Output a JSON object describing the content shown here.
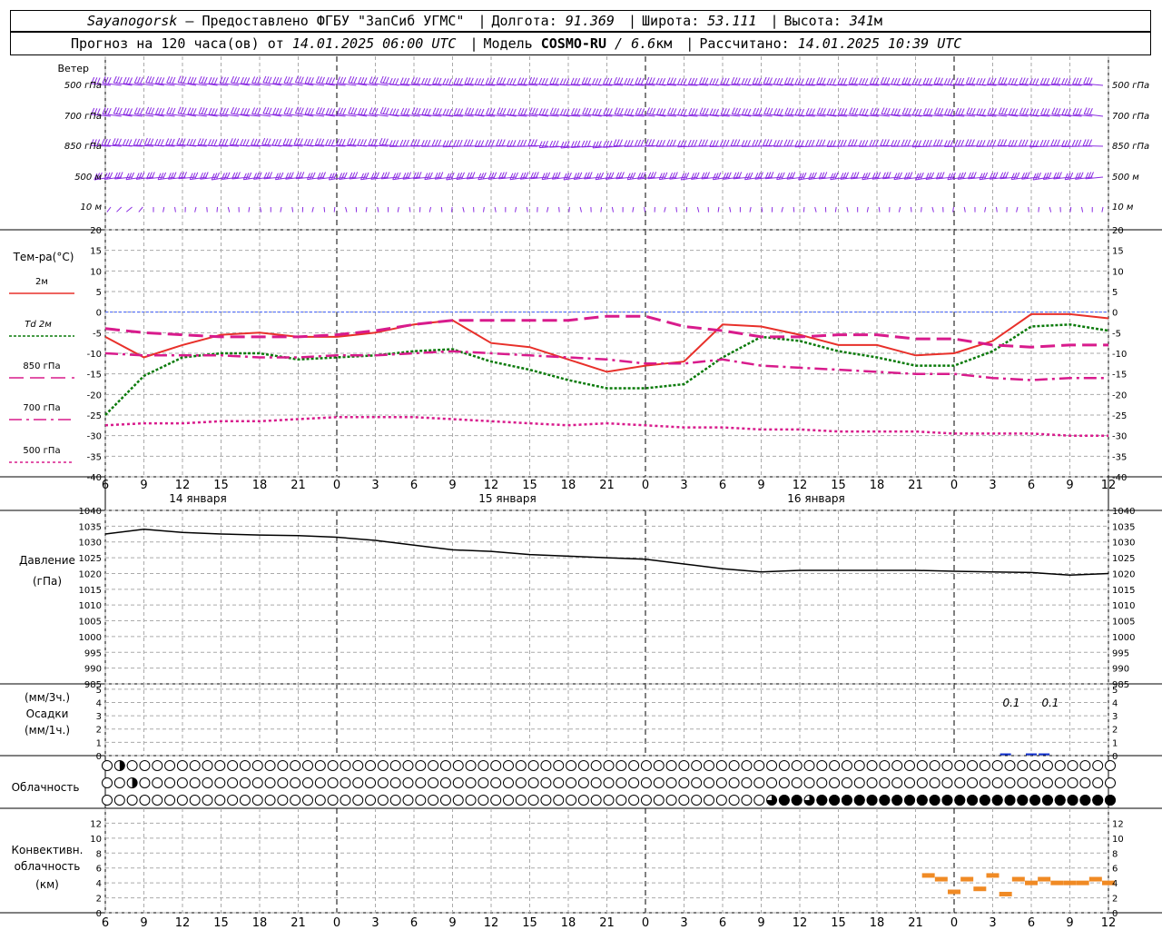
{
  "header": {
    "station": "Sayanogorsk",
    "provider_prefix": "—",
    "provider": "Предоставлено ФГБУ \"ЗапСиб УГМС\"",
    "lon_label": "Долгота:",
    "lon_value": "91.369",
    "lat_label": "Широта:",
    "lat_value": "53.111",
    "alt_label": "Высота:",
    "alt_value": "341",
    "alt_unit": "м",
    "forecast_label": "Прогноз на 120 часа(ов) от",
    "forecast_start": "14.01.2025 06:00 UTC",
    "model_label": "Модель",
    "model_name": "COSMO-RU",
    "model_res": "/ 6.6",
    "model_res_unit": "км",
    "calc_label": "Рассчитано:",
    "calc_time": "14.01.2025 10:39 UTC"
  },
  "wind_panel": {
    "title": "Ветер",
    "levels": [
      "500 гПа",
      "700 гПа",
      "850 гПа",
      "500 м",
      "10 м"
    ],
    "barb_color": "#8a2be2"
  },
  "temp_panel": {
    "title": "Тем-ра(°С)",
    "legend": [
      "2м",
      "Td 2м",
      "850 гПа",
      "700 гПа",
      "500 гПа"
    ],
    "yticks": [
      "20",
      "15",
      "10",
      "5",
      "0",
      "-5",
      "-10",
      "-15",
      "-20",
      "-25",
      "-30",
      "-35",
      "-40"
    ]
  },
  "pressure_panel": {
    "title": "Давление",
    "unit": "(гПа)",
    "yticks": [
      "1040",
      "1035",
      "1030",
      "1025",
      "1020",
      "1015",
      "1010",
      "1005",
      "1000",
      "995",
      "990",
      "985"
    ]
  },
  "precip_panel": {
    "unit_3h": "(мм/3ч.)",
    "title": "Осадки",
    "unit_1h": "(мм/1ч.)",
    "yticks": [
      "5",
      "4",
      "3",
      "2",
      "1",
      "0"
    ],
    "annotations": [
      "0.1",
      "0.1"
    ]
  },
  "cloud_panel": {
    "title": "Облачность"
  },
  "conv_panel": {
    "title_1": "Конвективн.",
    "title_2": "облачность",
    "unit": "(км)",
    "yticks": [
      "12",
      "10",
      "8",
      "6",
      "4",
      "2",
      "0"
    ]
  },
  "time_axis": {
    "ticks": [
      "6",
      "9",
      "12",
      "15",
      "18",
      "21",
      "0",
      "3",
      "6",
      "9",
      "12",
      "15",
      "18",
      "21",
      "0",
      "3",
      "6",
      "9",
      "12",
      "15",
      "18",
      "21",
      "0",
      "3",
      "6",
      "9",
      "12"
    ],
    "dates": [
      "14 января",
      "15 января",
      "16 января"
    ]
  },
  "colors": {
    "t2m": "#e8302a",
    "td2m": "#0a7a0a",
    "t850": "#d81b8c",
    "t700": "#d81b8c",
    "t500": "#d81b8c",
    "pressure": "#000000",
    "precip": "#1030d0",
    "conv": "#f08a24",
    "zero_line": "#4060ff"
  },
  "chart_data": {
    "type": "line",
    "x": [
      "14.01 06",
      "14.01 09",
      "14.01 12",
      "14.01 15",
      "14.01 18",
      "14.01 21",
      "15.01 00",
      "15.01 03",
      "15.01 06",
      "15.01 09",
      "15.01 12",
      "15.01 15",
      "15.01 18",
      "15.01 21",
      "16.01 00",
      "16.01 03",
      "16.01 06",
      "16.01 09",
      "16.01 12",
      "16.01 15",
      "16.01 18",
      "16.01 21",
      "17.01 00",
      "17.01 03",
      "17.01 06",
      "17.01 09",
      "17.01 12"
    ],
    "temperature": {
      "ylim": [
        -40,
        20
      ],
      "series": [
        {
          "name": "2м",
          "values": [
            -6,
            -11,
            -8,
            -5.5,
            -5,
            -6,
            -6,
            -5,
            -3,
            -2,
            -7.5,
            -8.5,
            -11.5,
            -14.5,
            -13,
            -12,
            -3,
            -3.5,
            -5.5,
            -8,
            -8,
            -10.5,
            -10,
            -7,
            -0.5,
            -0.5,
            -1.5
          ]
        },
        {
          "name": "Td 2м",
          "values": [
            -25,
            -15.5,
            -11,
            -10,
            -10,
            -11.5,
            -11,
            -10.5,
            -9.5,
            -9,
            -12,
            -14,
            -16.5,
            -18.5,
            -18.5,
            -17.5,
            -11,
            -6,
            -7,
            -9.5,
            -11,
            -13,
            -13,
            -9.5,
            -3.5,
            -3,
            -4.5
          ]
        },
        {
          "name": "850 гПа",
          "values": [
            -4,
            -5,
            -5.5,
            -6,
            -6,
            -6,
            -5.5,
            -4.5,
            -3,
            -2,
            -2,
            -2,
            -2,
            -1,
            -1,
            -3.5,
            -4.5,
            -6,
            -6,
            -5.5,
            -5.5,
            -6.5,
            -6.5,
            -8,
            -8.5,
            -8,
            -8
          ]
        },
        {
          "name": "700 гПа",
          "values": [
            -10,
            -10.5,
            -10.5,
            -10.5,
            -11,
            -11,
            -10.5,
            -10.5,
            -10,
            -9.5,
            -10,
            -10.5,
            -11,
            -11.5,
            -12.5,
            -12.5,
            -11.5,
            -13,
            -13.5,
            -14,
            -14.5,
            -15,
            -15,
            -16,
            -16.5,
            -16,
            -16
          ]
        },
        {
          "name": "500 гПа",
          "values": [
            -27.5,
            -27,
            -27,
            -26.5,
            -26.5,
            -26,
            -25.5,
            -25.5,
            -25.5,
            -26,
            -26.5,
            -27,
            -27.5,
            -27,
            -27.5,
            -28,
            -28,
            -28.5,
            -28.5,
            -29,
            -29,
            -29,
            -29.5,
            -29.5,
            -29.5,
            -30,
            -30
          ]
        }
      ]
    },
    "pressure": {
      "ylim": [
        985,
        1040
      ],
      "values": [
        1032.5,
        1034,
        1033,
        1032.5,
        1032.2,
        1032,
        1031.5,
        1030.5,
        1029,
        1027.5,
        1027,
        1026,
        1025.5,
        1025,
        1024.5,
        1023,
        1021.5,
        1020.5,
        1021,
        1021,
        1021,
        1021,
        1020.7,
        1020.5,
        1020.3,
        1019.5,
        1020
      ]
    },
    "precipitation": {
      "ylim": [
        0,
        5
      ],
      "bars": [
        {
          "hour": "17.01 04",
          "value": 0.1
        },
        {
          "hour": "17.01 06",
          "value": 0.1
        },
        {
          "hour": "17.01 07",
          "value": 0.1
        }
      ]
    },
    "cloud_cover_eighths": {
      "low": [
        0,
        0,
        0,
        0,
        0,
        0,
        0,
        0,
        0,
        0,
        0,
        0,
        0,
        0,
        0,
        0,
        0,
        0,
        0,
        0,
        0,
        0,
        0,
        0,
        0,
        0,
        0,
        0,
        0,
        0,
        0,
        0,
        0,
        0,
        0,
        0,
        0,
        0,
        0,
        0,
        0,
        0,
        0,
        0,
        0,
        0,
        0,
        0,
        0,
        0,
        0,
        0,
        0,
        0,
        0,
        0,
        0,
        0,
        0,
        0,
        0,
        0,
        0,
        0,
        0,
        0,
        0,
        0,
        0,
        0,
        0,
        0,
        0,
        0,
        0,
        0,
        0,
        0,
        0,
        0,
        0,
        0,
        0,
        0,
        0,
        0,
        0,
        0,
        0,
        0,
        0,
        0,
        0,
        0,
        0,
        0,
        0,
        0,
        0,
        0,
        0,
        0,
        0,
        0,
        0,
        0,
        0,
        0,
        0,
        0,
        0,
        0,
        0,
        0,
        6,
        6,
        8,
        8,
        8,
        8,
        8,
        6,
        8,
        8,
        8,
        8,
        8,
        8,
        8,
        6,
        8,
        8,
        8,
        8,
        8,
        8,
        8,
        8,
        8,
        8,
        8,
        8,
        8,
        8,
        8,
        8,
        8,
        8,
        8,
        8,
        8,
        8,
        8,
        8,
        8,
        8,
        8,
        8,
        8,
        8,
        8,
        8,
        8,
        8,
        8,
        8,
        8,
        8,
        8,
        8,
        8,
        8,
        6,
        8
      ],
      "mid": [
        0,
        0,
        0,
        0,
        4,
        0,
        0,
        0,
        0,
        0,
        0,
        0,
        0,
        0,
        0,
        0,
        0,
        0,
        0,
        0,
        0,
        0,
        0,
        0,
        0,
        0,
        0,
        0,
        0,
        0,
        0,
        0,
        0,
        0,
        0,
        0,
        0,
        0,
        0,
        0,
        0,
        0,
        0,
        0,
        0,
        0,
        0,
        0,
        0,
        0,
        0,
        0,
        0,
        0,
        0,
        0,
        0,
        0,
        0,
        0,
        0,
        0,
        0,
        0,
        0,
        0,
        0,
        0,
        0,
        0,
        0,
        0,
        0,
        0,
        0,
        0,
        0,
        0,
        0,
        0,
        0,
        0,
        0,
        0,
        0,
        0,
        0,
        0,
        0,
        0,
        0,
        0,
        0,
        0,
        0,
        0,
        0,
        0,
        0,
        0,
        0,
        0,
        0,
        0,
        0,
        0,
        0,
        0,
        0,
        0,
        0,
        0,
        0,
        0,
        0,
        0,
        0,
        0,
        0,
        0,
        0,
        0,
        0,
        0,
        0,
        0,
        0,
        0,
        0,
        0,
        0,
        0,
        0,
        0,
        0,
        0,
        0,
        0,
        0,
        0,
        0,
        0,
        0,
        0,
        0,
        0,
        0,
        0,
        0,
        0,
        0,
        0,
        0,
        0,
        0,
        0,
        0,
        0,
        0,
        0
      ],
      "high": [
        0,
        6,
        4,
        0,
        0,
        0,
        0,
        0,
        0,
        0,
        0,
        0,
        0,
        0,
        0,
        0,
        0,
        0,
        0,
        0,
        0,
        0,
        0,
        0,
        0,
        0,
        0,
        0,
        0,
        0,
        0,
        0,
        0,
        0,
        0,
        0,
        0,
        0,
        0,
        0,
        0,
        0,
        0,
        0,
        0,
        0,
        0,
        0,
        0,
        0,
        0,
        0,
        0,
        0,
        0,
        0,
        0,
        0,
        0,
        0,
        0,
        0,
        0,
        0,
        0,
        0,
        0,
        0,
        0,
        0,
        0,
        0,
        0,
        0,
        0,
        0,
        0,
        0,
        0,
        0,
        0,
        0,
        0,
        0,
        0,
        0,
        0,
        0,
        0,
        0,
        0,
        0,
        0,
        0,
        0,
        0,
        0,
        0,
        0,
        0,
        0,
        0,
        0,
        0,
        0,
        0,
        0,
        0,
        0,
        0,
        0,
        0,
        0,
        0,
        0,
        0,
        0,
        0,
        0,
        0,
        0,
        0,
        0,
        0,
        0,
        0,
        0,
        0,
        0,
        0,
        0,
        0,
        0,
        0,
        0,
        0,
        0,
        0,
        0,
        0,
        0,
        0,
        0,
        0,
        0,
        0,
        0,
        0,
        0,
        0,
        0,
        0,
        0,
        0,
        0,
        0,
        0,
        0,
        0,
        0
      ]
    },
    "convective_cloud": {
      "ylim": [
        0,
        13
      ],
      "segments": [
        {
          "hour": "16.01 22",
          "base_km": 5
        },
        {
          "hour": "16.01 23",
          "base_km": 4.5
        },
        {
          "hour": "17.01 00",
          "base_km": 2.8
        },
        {
          "hour": "17.01 01",
          "base_km": 4.5
        },
        {
          "hour": "17.01 02",
          "base_km": 3.2
        },
        {
          "hour": "17.01 03",
          "base_km": 5
        },
        {
          "hour": "17.01 04",
          "base_km": 2.5
        },
        {
          "hour": "17.01 05",
          "base_km": 4.5
        },
        {
          "hour": "17.01 06",
          "base_km": 4
        },
        {
          "hour": "17.01 07",
          "base_km": 4.5
        },
        {
          "hour": "17.01 08",
          "base_km": 4
        },
        {
          "hour": "17.01 09",
          "base_km": 4
        },
        {
          "hour": "17.01 10",
          "base_km": 4
        },
        {
          "hour": "17.01 11",
          "base_km": 4.5
        },
        {
          "hour": "17.01 12",
          "base_km": 4
        }
      ]
    },
    "wind_barbs_dir_deg": {
      "500 гПа": [
        290,
        290,
        290,
        290,
        290,
        290,
        290,
        290,
        280,
        280,
        280,
        280,
        280,
        280,
        280,
        280,
        280,
        280,
        280,
        280,
        280,
        280,
        280,
        280,
        280,
        280,
        280
      ],
      "700 гПа": [
        290,
        290,
        290,
        290,
        290,
        290,
        290,
        290,
        285,
        285,
        285,
        285,
        285,
        285,
        285,
        285,
        285,
        285,
        285,
        285,
        285,
        285,
        285,
        285,
        285,
        285,
        285
      ],
      "850 гПа": [
        280,
        280,
        280,
        280,
        280,
        280,
        280,
        280,
        270,
        270,
        270,
        270,
        260,
        260,
        270,
        270,
        270,
        270,
        270,
        270,
        270,
        270,
        270,
        270,
        270,
        270,
        270
      ],
      "500 м": [
        250,
        250,
        250,
        250,
        250,
        250,
        250,
        250,
        250,
        250,
        250,
        250,
        250,
        250,
        250,
        250,
        250,
        250,
        250,
        250,
        250,
        250,
        250,
        250,
        250,
        250,
        250
      ],
      "10 м": [
        200,
        180,
        180,
        180,
        180,
        180,
        180,
        180,
        180,
        180,
        180,
        180,
        180,
        180,
        180,
        180,
        180,
        180,
        180,
        180,
        180,
        180,
        180,
        180,
        180,
        180,
        180
      ]
    }
  }
}
